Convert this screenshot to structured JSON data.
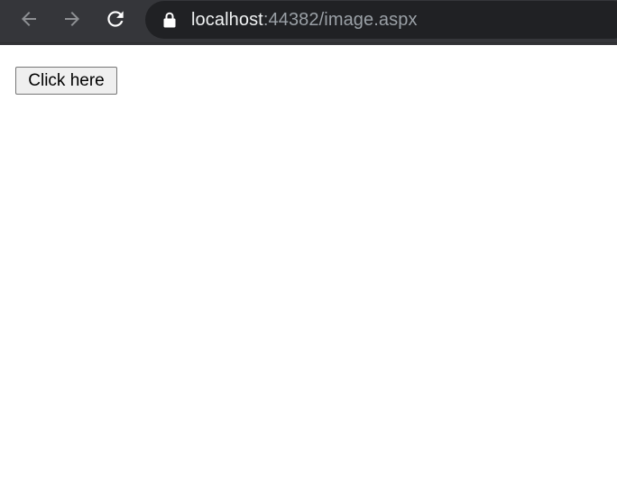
{
  "browser": {
    "url_host": "localhost",
    "url_rest": ":44382/image.aspx",
    "icons": {
      "back": "arrow-left-icon",
      "forward": "arrow-right-icon",
      "reload": "reload-icon",
      "security": "lock-icon"
    },
    "colors": {
      "toolbar": "#35363a",
      "omnibox": "#202124",
      "host_text": "#f1f3f4",
      "path_text": "#9aa0a6"
    }
  },
  "page": {
    "button_label": "Click here"
  }
}
